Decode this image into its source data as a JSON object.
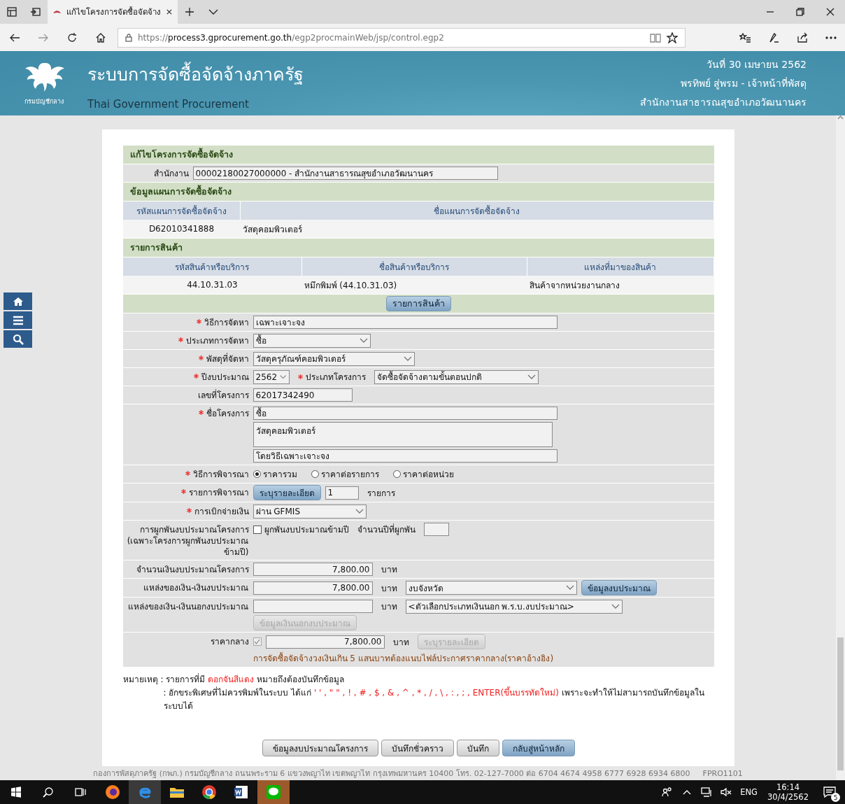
{
  "browser": {
    "tab_title": "แก้ไขโครงการจัดซื้อจัดจ้าง",
    "url_scheme": "https://",
    "url_host": "process3.gprocurement.go.th",
    "url_path": "/egp2procmainWeb/jsp/control.egp2"
  },
  "header": {
    "title": "ระบบการจัดซื้อจัดจ้างภาครัฐ",
    "subtitle": "Thai Government Procurement",
    "logo_text": "กรมบัญชีกลาง",
    "date": "วันที่ 30 เมษายน 2562",
    "user": "พรทิพย์ สู่พรม - เจ้าหน้าที่พัสดุ",
    "office": "สำนักงานสาธารณสุขอำเภอวัฒนานคร"
  },
  "form": {
    "title": "แก้ไขโครงการจัดซื้อจัดจ้าง",
    "office_label": "สำนักงาน",
    "office_value": "00002180027000000 - สำนักงานสาธารณสุขอำเภอวัฒนานคร",
    "plan": {
      "title": "ข้อมูลแผนการจัดซื้อจัดจ้าง",
      "columns": [
        "รหัสแผนการจัดซื้อจัดจ้าง",
        "ชื่อแผนการจัดซื้อจัดจ้าง"
      ],
      "rows": [
        [
          "D62010341888",
          "วัสดุคอมพิวเตอร์"
        ]
      ]
    },
    "items": {
      "title": "รายการสินค้า",
      "columns": [
        "รหัสสินค้าหรือบริการ",
        "ชื่อสินค้าหรือบริการ",
        "แหล่งที่มาของสินค้า"
      ],
      "rows": [
        [
          "44.10.31.03",
          "หมึกพิมพ์ (44.10.31.03)",
          "สินค้าจากหน่วยงานกลาง"
        ]
      ],
      "button": "รายการสินค้า"
    },
    "fields": [
      {
        "label": "วิธีการจัดหา",
        "required": true,
        "lines": [
          [
            {
              "kind": "text",
              "value": "เฉพาะเจาะจง"
            }
          ]
        ]
      },
      {
        "label": "ประเภทการจัดหา",
        "required": true,
        "lines": [
          [
            {
              "kind": "select",
              "value": "ซื้อ"
            }
          ]
        ]
      },
      {
        "label": "พัสดุที่จัดหา",
        "required": true,
        "lines": [
          [
            {
              "kind": "select",
              "value": "วัสดุครุภัณฑ์คอมพิวเตอร์"
            }
          ]
        ]
      },
      {
        "label": "ปีงบประมาณ",
        "required": true,
        "lines": [
          [
            {
              "kind": "select",
              "value": "2562"
            },
            {
              "kind": "caption",
              "text": "ประเภทโครงการ",
              "required": true
            },
            {
              "kind": "select",
              "value": "จัดซื้อจัดจ้างตามขั้นตอนปกติ"
            }
          ]
        ]
      },
      {
        "label": "เลขที่โครงการ",
        "required": false,
        "lines": [
          [
            {
              "kind": "text",
              "value": "62017342490"
            }
          ]
        ]
      },
      {
        "label": "ชื่อโครงการ",
        "required": true,
        "lines": [
          [
            {
              "kind": "text",
              "value": "ซื้อ"
            }
          ],
          [
            {
              "kind": "textarea",
              "value": "วัสดุคอมพิวเตอร์"
            }
          ],
          [
            {
              "kind": "text",
              "value": "โดยวิธีเฉพาะเจาะจง"
            }
          ]
        ]
      },
      {
        "label": "วิธีการพิจารณา",
        "required": true,
        "lines": [
          [
            {
              "kind": "radio",
              "label": "ราคารวม",
              "selected": true
            },
            {
              "kind": "radio",
              "label": "ราคาต่อรายการ",
              "selected": false
            },
            {
              "kind": "radio",
              "label": "ราคาต่อหน่วย",
              "selected": false
            }
          ]
        ]
      },
      {
        "label": "รายการพิจารณา",
        "required": true,
        "lines": [
          [
            {
              "kind": "button",
              "label": "ระบุรายละเอียด",
              "disabled": false
            },
            {
              "kind": "text",
              "value": "1"
            },
            {
              "kind": "caption",
              "text": "รายการ",
              "required": false
            }
          ]
        ]
      },
      {
        "label": "การเบิกจ่ายเงิน",
        "required": true,
        "lines": [
          [
            {
              "kind": "select",
              "value": "ผ่าน GFMIS"
            }
          ]
        ]
      },
      {
        "label": "การผูกพันงบประมาณโครงการ (เฉพาะโครงการผูกพันงบประมาณข้ามปี)",
        "required": false,
        "lines": [
          [
            {
              "kind": "checkbox",
              "label": "ผูกพันงบประมาณข้ามปี",
              "checked": false,
              "disabled": false
            },
            {
              "kind": "caption",
              "text": "จำนวนปีที่ผูกพัน",
              "required": false
            },
            {
              "kind": "text"
            }
          ]
        ]
      },
      {
        "label": "จำนวนเงินงบประมาณโครงการ",
        "required": false,
        "lines": [
          [
            {
              "kind": "amount",
              "value": "7,800.00"
            },
            {
              "kind": "caption",
              "text": "บาท",
              "required": false
            }
          ]
        ]
      },
      {
        "label": "แหล่งของเงิน-เงินงบประมาณ",
        "required": false,
        "lines": [
          [
            {
              "kind": "amount",
              "value": "7,800.00"
            },
            {
              "kind": "caption",
              "text": "บาท",
              "required": false
            },
            {
              "kind": "select",
              "value": "งบจังหวัด"
            },
            {
              "kind": "button",
              "label": "ข้อมูลงบประมาณ",
              "disabled": false
            }
          ]
        ]
      },
      {
        "label": "แหล่งของเงิน-เงินนอกงบประมาณ",
        "required": false,
        "lines": [
          [
            {
              "kind": "amount"
            },
            {
              "kind": "caption",
              "text": "บาท",
              "required": false
            },
            {
              "kind": "select",
              "value": "<ตัวเลือกประเภทเงินนอก พ.ร.บ.งบประมาณ>"
            }
          ],
          [
            {
              "kind": "button",
              "label": "ข้อมูลเงินนอกงบประมาณ",
              "disabled": true
            }
          ]
        ]
      },
      {
        "label": "ราคากลาง",
        "required": false,
        "lines": [
          [
            {
              "kind": "checkbox",
              "checked": true,
              "disabled": true
            },
            {
              "kind": "amount",
              "value": "7,800.00"
            },
            {
              "kind": "caption",
              "text": "บาท",
              "required": false
            },
            {
              "kind": "button",
              "label": "ระบุรายละเอียด",
              "disabled": true
            }
          ],
          [
            {
              "kind": "note",
              "text": "การจัดซื้อจัดจ้างวงเงินเกิน 5 แสนบาทต้องแนบไฟล์ประกาศราคากลาง(ราคาอ้างอิง)"
            }
          ]
        ]
      }
    ],
    "notes": {
      "label": "หมายเหตุ",
      "lines": [
        [
          {
            "kind": "plain",
            "text": ": รายการที่มี "
          },
          {
            "kind": "alert",
            "text": "ดอกจันสีแดง"
          },
          {
            "kind": "plain",
            "text": " หมายถึงต้องบันทึกข้อมูล"
          }
        ],
        [
          {
            "kind": "plain",
            "text": ": อักขระพิเศษที่ไม่ควรพิมพ์ในระบบ ได้แก่ "
          },
          {
            "kind": "alert",
            "text": "' ' , \" \" , ! , # , $ , & , ^ , * , / , \\ , : , ; , ENTER(ขึ้นบรรทัดใหม่)"
          },
          {
            "kind": "plain",
            "text": " เพราะจะทำให้ไม่สามารถบันทึกข้อมูลในระบบได้"
          }
        ]
      ]
    },
    "buttons": [
      {
        "label": "ข้อมูลงบประมาณโครงการ",
        "kind": "secondary"
      },
      {
        "label": "บันทึกชั่วคราว",
        "kind": "secondary"
      },
      {
        "label": "บันทึก",
        "kind": "secondary"
      },
      {
        "label": "กลับสู่หน้าหลัก",
        "kind": "primary"
      }
    ]
  },
  "footer": {
    "address": "กองการพัสดุภาครัฐ (กพภ.) กรมบัญชีกลาง ถนนพระราม 6 แขวงพญาไท เขตพญาไท กรุงเทพมหานคร 10400 โทร.",
    "phone": "02-127-7000",
    "extensions": "ต่อ 6704 4674 4958 6777 6928 6934 6800",
    "code": "FPRO1101"
  },
  "taskbar": {
    "language": "ENG",
    "time": "16:14",
    "date": "30/4/2562",
    "notifications": "5"
  }
}
